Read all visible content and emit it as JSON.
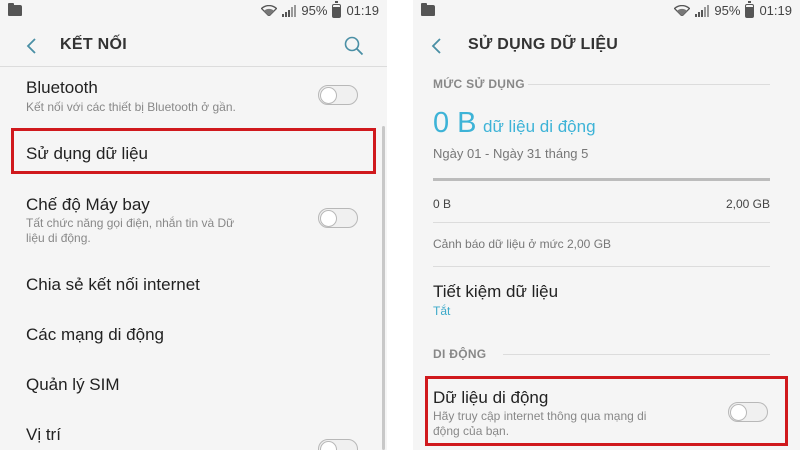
{
  "status_bar": {
    "battery": "95%",
    "time": "01:19"
  },
  "left": {
    "title": "KẾT NỐI",
    "items": [
      {
        "title": "Bluetooth",
        "subtitle": "Kết nối với các thiết bị Bluetooth ở gần."
      },
      {
        "title": "Sử dụng dữ liệu"
      },
      {
        "title": "Chế độ Máy bay",
        "subtitle_line1": "Tất chức năng gọi điện, nhắn tin và Dữ",
        "subtitle_line2": "liệu di động."
      },
      {
        "title": "Chia sẻ kết nối internet"
      },
      {
        "title": "Các mạng di động"
      },
      {
        "title": "Quản lý SIM"
      },
      {
        "title": "Vị trí"
      }
    ]
  },
  "right": {
    "title": "SỬ DỤNG DỮ LIỆU",
    "usage_section": "MỨC SỬ DỤNG",
    "usage_value": "0 B",
    "usage_unit": "dữ liệu di động",
    "period": "Ngày 01 - Ngày 31 tháng 5",
    "bar_min": "0 B",
    "bar_max": "2,00 GB",
    "warning": "Cảnh báo dữ liệu ở mức 2,00 GB",
    "saver_title": "Tiết kiệm dữ liệu",
    "saver_status": "Tắt",
    "mobile_section": "DI ĐỘNG",
    "mobile_data_title": "Dữ liệu di động",
    "mobile_data_sub_line1": "Hãy truy cập internet thông qua mạng di",
    "mobile_data_sub_line2": "động của bạn."
  },
  "colors": {
    "accent": "#3db3d7",
    "highlight": "#d0191d",
    "background": "#f5f5f5"
  }
}
